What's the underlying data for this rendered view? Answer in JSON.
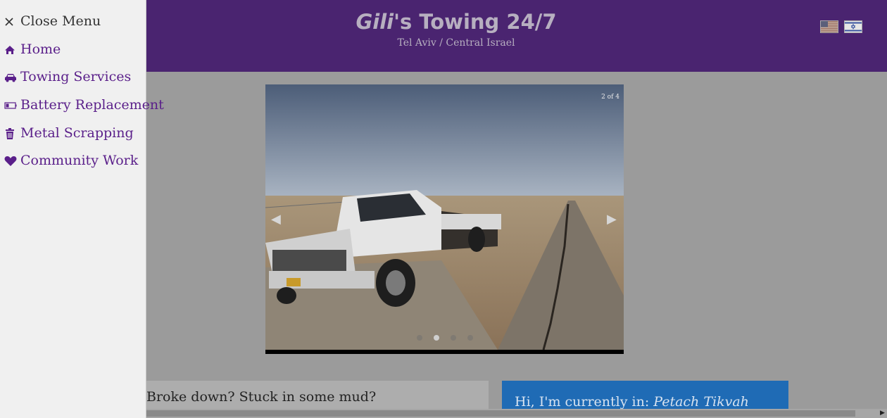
{
  "header": {
    "title_name": "Gili",
    "title_rest": "'s Towing 24/7",
    "subtitle": "Tel Aviv / Central Israel",
    "languages": [
      "english-flag",
      "hebrew-flag"
    ]
  },
  "menu": {
    "close_label": "Close Menu",
    "items": [
      {
        "label": "Home",
        "icon": "home-icon"
      },
      {
        "label": "Towing Services",
        "icon": "car-icon"
      },
      {
        "label": "Battery Replacement",
        "icon": "battery-icon"
      },
      {
        "label": "Metal Scrapping",
        "icon": "trash-icon"
      },
      {
        "label": "Community Work",
        "icon": "heart-icon"
      }
    ]
  },
  "slideshow": {
    "counter": "2 of 4",
    "total": 4,
    "current": 2
  },
  "content": {
    "left_card_text": "Broke down? Stuck in some mud?",
    "right_card_prefix": "Hi, I'm currently in: ",
    "right_card_location": "Petach Tikvah"
  },
  "colors": {
    "header_bg": "#4a2470",
    "menu_accent": "#5a1f8a",
    "location_card_bg": "#1f6bb5"
  }
}
